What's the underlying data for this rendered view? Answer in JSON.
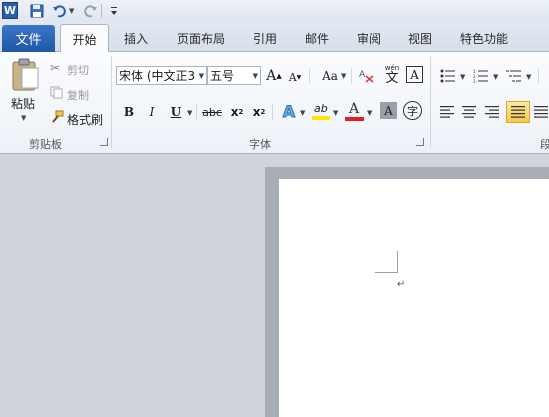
{
  "app": {
    "icon_letter": "W"
  },
  "quick_access": {
    "items": [
      "save-icon",
      "undo-icon",
      "redo-icon",
      "customize-icon"
    ]
  },
  "tabs": {
    "file": "文件",
    "items": [
      "开始",
      "插入",
      "页面布局",
      "引用",
      "邮件",
      "审阅",
      "视图",
      "特色功能"
    ]
  },
  "clipboard": {
    "paste": "粘贴",
    "cut": "剪切",
    "copy": "复制",
    "format_painter": "格式刷",
    "group_label": "剪贴板"
  },
  "font": {
    "font_name": "宋体 (中文正3",
    "font_size": "五号",
    "grow": "A",
    "shrink": "A",
    "change_case": "Aa",
    "phonetic": "wén",
    "phonetic_char": "文",
    "border_char": "A",
    "bold": "B",
    "italic": "I",
    "underline": "U",
    "strike": "abc",
    "subscript": "x",
    "superscript": "x",
    "sub_mark": "2",
    "sup_mark": "2",
    "text_effect": "A",
    "highlight": "ab",
    "font_color": "A",
    "shading": "A",
    "enclose_char": "字",
    "group_label": "字体"
  },
  "paragraph": {
    "group_label": "段"
  },
  "colors": {
    "file_tab": "#2a66b8",
    "font_color_bar": "#e02020",
    "highlight_bar": "#ffe600"
  },
  "document": {
    "paragraph_mark": "↵"
  }
}
